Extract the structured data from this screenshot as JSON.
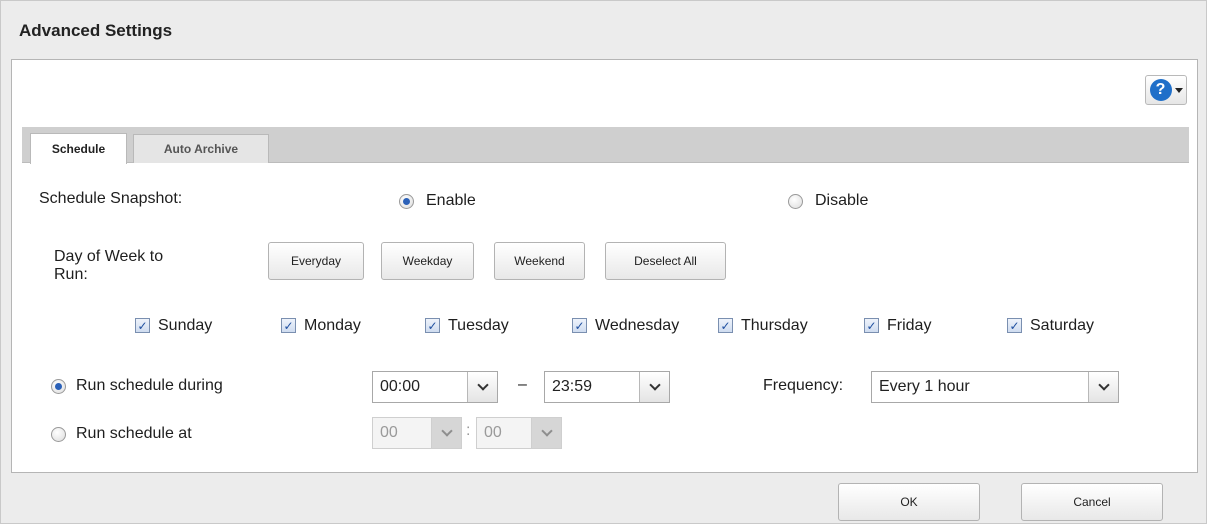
{
  "dialog": {
    "title": "Advanced Settings"
  },
  "help": {
    "icon": "help-icon",
    "glyph": "?"
  },
  "tabs": [
    {
      "label": "Schedule",
      "active": true
    },
    {
      "label": "Auto Archive",
      "active": false
    }
  ],
  "schedule": {
    "snapshot_label": "Schedule Snapshot:",
    "enable_label": "Enable",
    "disable_label": "Disable",
    "selected": "Enable",
    "day_label_line1": "Day of Week to",
    "day_label_line2": "Run:",
    "quick_buttons": [
      "Everyday",
      "Weekday",
      "Weekend",
      "Deselect All"
    ],
    "days": [
      {
        "label": "Sunday",
        "checked": true
      },
      {
        "label": "Monday",
        "checked": true
      },
      {
        "label": "Tuesday",
        "checked": true
      },
      {
        "label": "Wednesday",
        "checked": true
      },
      {
        "label": "Thursday",
        "checked": true
      },
      {
        "label": "Friday",
        "checked": true
      },
      {
        "label": "Saturday",
        "checked": true
      }
    ],
    "run_during_label": "Run schedule during",
    "run_at_label": "Run schedule at",
    "run_mode": "during",
    "during_start": "00:00",
    "during_dash": "–",
    "during_end": "23:59",
    "frequency_label": "Frequency:",
    "frequency_value": "Every 1 hour",
    "at_hour": "00",
    "at_colon": ":",
    "at_minute": "00"
  },
  "footer": {
    "ok_label": "OK",
    "cancel_label": "Cancel"
  },
  "colors": {
    "accent": "#1f6fc9",
    "radio_dot": "#2b61b8",
    "check": "#1f4fa0"
  }
}
